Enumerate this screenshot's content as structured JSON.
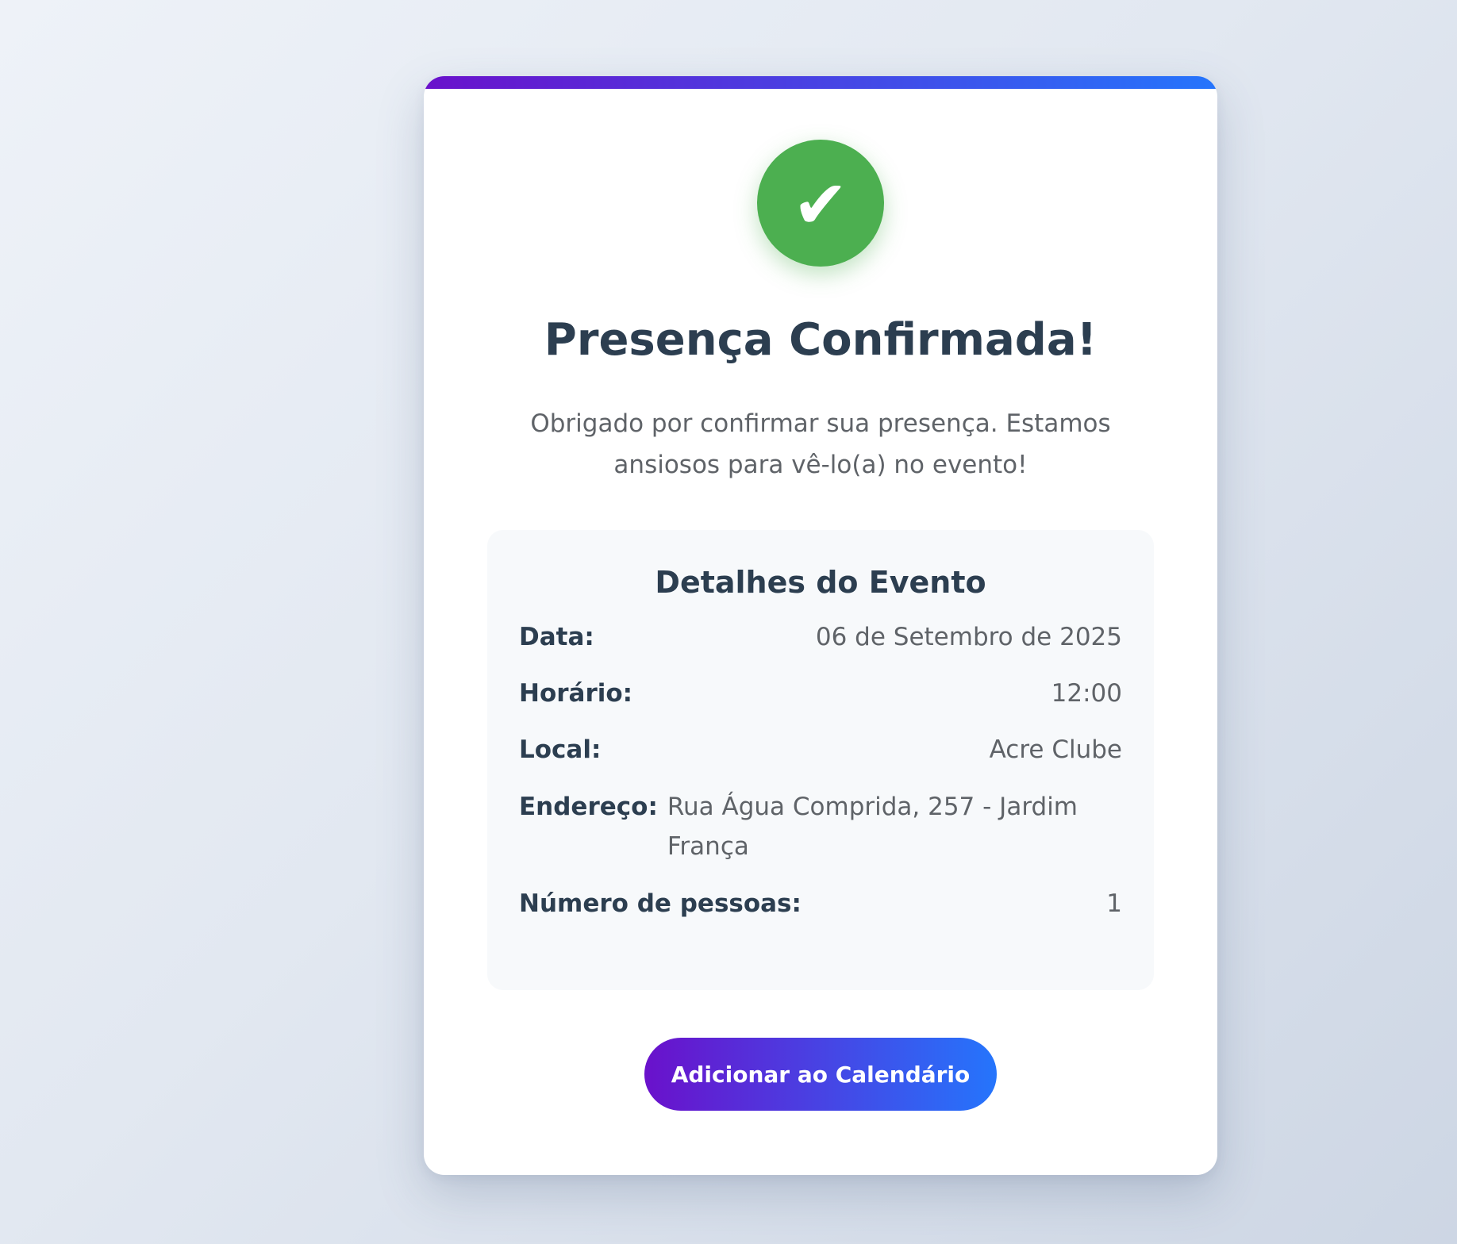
{
  "confirmation": {
    "icon": "check-icon",
    "icon_glyph": "✔",
    "title": "Presença Confirmada!",
    "message": "Obrigado por confirmar sua presença. Estamos ansiosos para vê-lo(a) no evento!"
  },
  "details": {
    "title": "Detalhes do Evento",
    "rows": [
      {
        "label": "Data:",
        "value": "06 de Setembro de 2025"
      },
      {
        "label": "Horário:",
        "value": "12:00"
      },
      {
        "label": "Local:",
        "value": "Acre Clube"
      },
      {
        "label": "Endereço:",
        "value": "Rua Água Comprida, 257 - Jardim França"
      },
      {
        "label": "Número de pessoas:",
        "value": "1"
      }
    ]
  },
  "actions": {
    "add_to_calendar_label": "Adicionar ao Calendário"
  },
  "colors": {
    "accent_start": "#6a11cb",
    "accent_end": "#2575fc",
    "success": "#4caf50",
    "heading": "#2c3e50",
    "body_text": "#5f6368"
  }
}
